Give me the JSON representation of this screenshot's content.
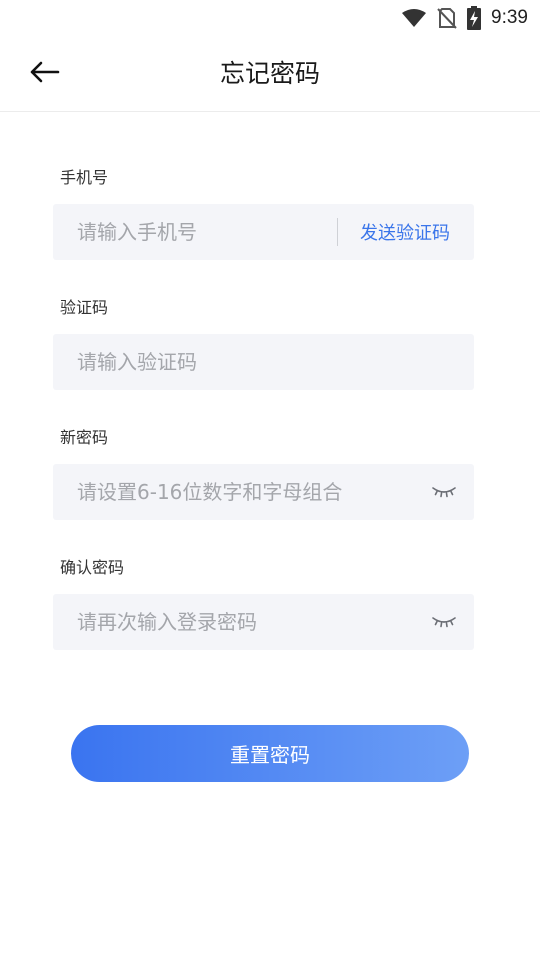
{
  "status_bar": {
    "time": "9:39",
    "icons": [
      "wifi-icon",
      "no-sim-icon",
      "battery-charging-icon"
    ]
  },
  "header": {
    "title": "忘记密码",
    "back_icon": "arrow-left-icon"
  },
  "form": {
    "phone": {
      "label": "手机号",
      "placeholder": "请输入手机号",
      "value": "",
      "send_code_label": "发送验证码"
    },
    "code": {
      "label": "验证码",
      "placeholder": "请输入验证码",
      "value": ""
    },
    "new_password": {
      "label": "新密码",
      "placeholder": "请设置6-16位数字和字母组合",
      "value": "",
      "toggle_icon": "eye-closed-icon"
    },
    "confirm_password": {
      "label": "确认密码",
      "placeholder": "请再次输入登录密码",
      "value": "",
      "toggle_icon": "eye-closed-icon"
    },
    "submit_label": "重置密码"
  },
  "colors": {
    "accent": "#3a75ea",
    "button_gradient_start": "#3a74f0",
    "button_gradient_end": "#6d9ff6",
    "field_background": "#f4f5f9",
    "placeholder": "#a4a6ab"
  }
}
